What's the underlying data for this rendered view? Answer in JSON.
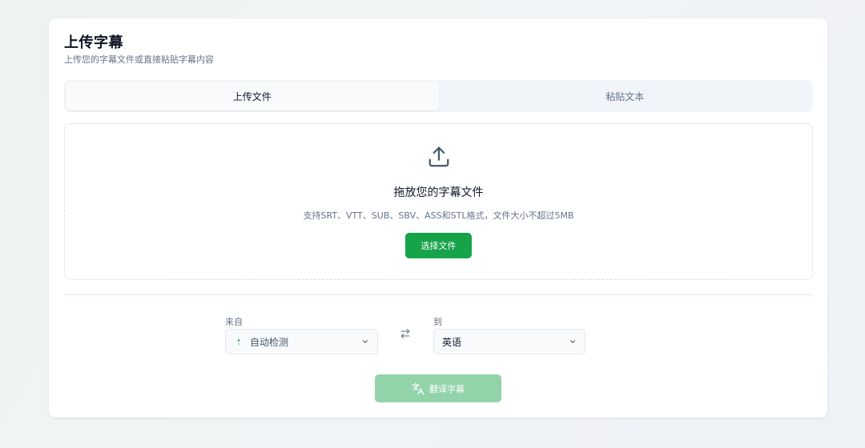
{
  "header": {
    "title": "上传字幕",
    "subtitle": "上传您的字幕文件或直接粘贴字幕内容"
  },
  "tabs": [
    {
      "label": "上传文件",
      "active": true
    },
    {
      "label": "粘贴文本",
      "active": false
    }
  ],
  "dropzone": {
    "icon": "upload-icon",
    "title": "拖放您的字幕文件",
    "hint": "支持SRT、VTT、SUB、SBV、ASS和STL格式，文件大小不超过5MB",
    "button_label": "选择文件"
  },
  "languages": {
    "from_label": "来自",
    "from_value": "自动检测",
    "to_label": "到",
    "to_value": "英语",
    "swap_icon": "swap-arrows-icon"
  },
  "action": {
    "translate_label": "翻译字幕",
    "icon": "translate-icon"
  },
  "colors": {
    "accent": "#16a34a",
    "accent_disabled": "#93d3aa"
  }
}
